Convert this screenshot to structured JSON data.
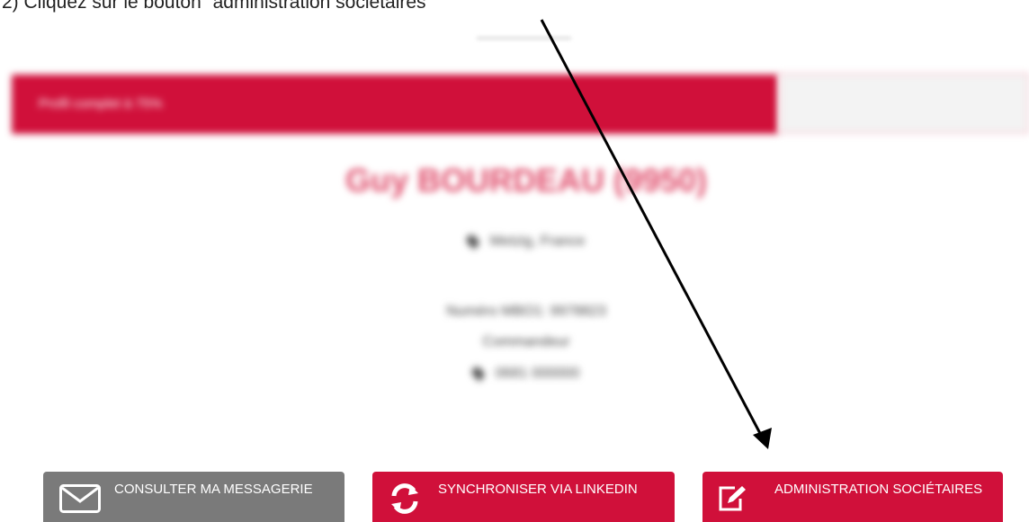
{
  "instruction": {
    "text": "2)    Cliquez sur le bouton “administration sociétaires”"
  },
  "banner": {
    "text": "Profil complet à 75%"
  },
  "profile": {
    "name": "Guy BOURDEAU (9950)",
    "location": "Metzig, France",
    "member_number": "Numéro MBO1: 9978823",
    "role": "Commandeur",
    "phone": "0681 000000"
  },
  "actions": [
    {
      "label": "Consulter ma messagerie",
      "icon": "envelope-icon",
      "color": "#7a7a7a"
    },
    {
      "label": "Synchroniser via LinkedIn",
      "icon": "refresh-icon",
      "color": "#d0103a"
    },
    {
      "label": "Administration sociétaires",
      "icon": "edit-icon",
      "color": "#d0103a"
    }
  ],
  "colors": {
    "brand_red": "#d0103a",
    "button_gray": "#7a7a7a",
    "name_pink": "#e0506e"
  }
}
